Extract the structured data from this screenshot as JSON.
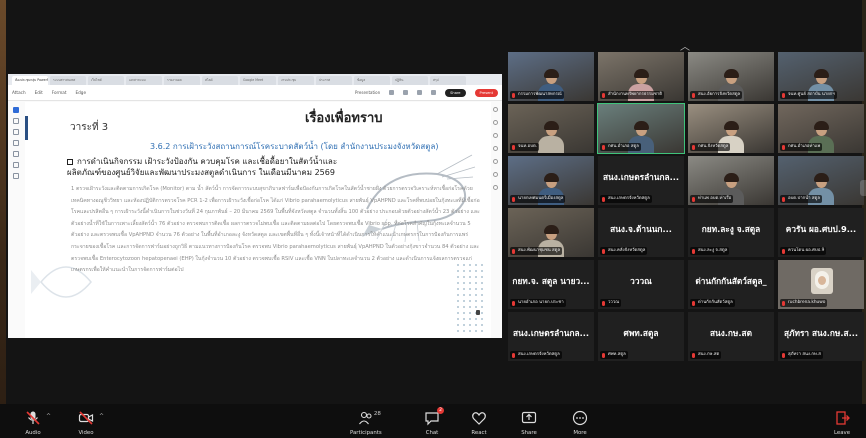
{
  "shared_screen": {
    "tabs": [
      "ห้องประชุมกลุ่ม PowerPoint",
      "ระบบสารสนเทศ",
      "เว็บไซต์",
      "เอกสารแนบ",
      "รายงานผล",
      "สไลด์",
      "Google Meet",
      "งานประชุม",
      "ประกาศ",
      "ข้อมูล",
      "ปฏิทิน",
      "สรุป"
    ],
    "menu": [
      "Attach",
      "Edit",
      "Format",
      "Edge"
    ],
    "view_label": "Presentation",
    "share_label": "Share",
    "present_label": "Present",
    "slide": {
      "agenda": "วาระที่ 3",
      "title": "เรื่องเพื่อทราบ",
      "subheading": "3.6.2 การเฝ้าระวังสถานการณ์โรคระบาดสัตว์น้ำ (โดย สำนักงานประมงจังหวัดสตูล)",
      "bullet": "การดำเนินกิจกรรม เฝ้าระวังป้องกัน ควบคุมโรค และเชื้อดื้อยาในสัตว์น้ำและผลิตภัณฑ์ของศูนย์วิจัยและพัฒนาประมงสตูลดำเนินการ ในเดือนมีนาคม 2569",
      "body": "1 ตรวจเฝ้าระวังและติดตามการเกิดโรค (Monitor) ตาม น้ำ สัตว์น้ำ การจัดการระบบสุขาภิบาลฟาร์มเพื่อป้องกันการเกิดโรคในสัตว์น้ำชายฝั่ง ด้วยการตรวจวิเคราะห์หาเชื้อก่อโรคด้วยเทคนิคทางอณูชีววิทยา และห้องปฏิบัติการตรวจโรค PCR 1-2 เพื่อการเฝ้าระวังเชื้อก่อโรค ได้แก่ Vibrio parahaemolyticus สายพันธุ์ VpAHPND และโรคที่พบบ่อยในกุ้งทะเลที่มีเชื้อก่อโรคและปรสิตอื่น ๆ การเฝ้าระวังนี้ดำเนินการในช่วงวันที่ 24 กุมภาพันธ์ – 20 มีนาคม 2569 ในพื้นที่จังหวัดสตูล จำนวนทั้งสิ้น 100 ตัวอย่าง ประกอบด้วยตัวอย่างสัตว์น้ำ 23 ตัวอย่าง และตัวอย่างน้ำที่ใช้ในการเพาะเลี้ยงสัตว์น้ำ 76 ตัวอย่าง ตรวจพบการติดเชื้อ ผลการตรวจไม่พบเชื้อ และติดตามผลต่อไป โดยตรวจพบเชื้อ Vibrio spp. ที่ก่อโรคสำคัญในกุ้งทะเลจำนวน 5 ตัวอย่าง และตรวจพบเชื้อ VpAHPND จำนวน 76 ตัวอย่าง ในพื้นที่อำเภอละงู จังหวัดสตูล และเขตพื้นที่อื่น ๆ ทั้งนี้เจ้าหน้าที่ได้ดำเนินการให้คำแนะนำเกษตรกรในการป้องกันการแพร่กระจายของเชื้อโรค และการจัดการฟาร์มอย่างถูกวิธี ตามแนวทางการป้องกันโรค ตรวจพบ Vibrio parahaemolyticus สายพันธุ์ VpAHPND ในตัวอย่างกุ้งขาวจำนวน 84 ตัวอย่าง และตรวจพบเชื้อ Enterocytozoon hepatopenaei (EHP) ในกุ้งจำนวน 10 ตัวอย่าง ตรวจพบเชื้อ RSIV และเชื้อ VNN ในปลาทะเลจำนวน 2 ตัวอย่าง และดำเนินการแจ้งผลการตรวจแก่เกษตรกรเพื่อให้คำแนะนำในการจัดการฟาร์มต่อไป"
    }
  },
  "participants_tiles": [
    {
      "name": "กรรมการพัฒนาสหกรณ์",
      "video": true
    },
    {
      "name": "สำนักงานทรัพยากรธรรมชาติ",
      "video": true
    },
    {
      "name": "สนง.อัยการจังหวัดสตูล",
      "video": true
    },
    {
      "name": "จนท.ศูนย์ สถาบัน นายกฯ",
      "video": true
    },
    {
      "name": "จนท.อบต.",
      "video": true
    },
    {
      "name": "กศน.อำเภอ สตูล",
      "video": true
    },
    {
      "name": "กศน.จังหวัดสตูล",
      "video": true
    },
    {
      "name": "กศน.อำเภอท่าแพ",
      "video": true
    },
    {
      "name": "นายกเทศมนตรีเมืองสตูล",
      "video": true,
      "big": ""
    },
    {
      "name": "สนง.เกษตรจังหวัดสตูล",
      "video": false,
      "big": "สนง.เกษตรลำนกล..."
    },
    {
      "name": "ท่าแพ อบต.ท่าเรือ",
      "video": true
    },
    {
      "name": "อบต.ปากน้ำ สตูล",
      "video": true
    },
    {
      "name": "สนง.พัฒนาชุมชน สตูล",
      "video": true
    },
    {
      "name": "สนง.คลังจังหวัดสตูล",
      "video": false,
      "big": "สนง.จ.ด้านนก..."
    },
    {
      "name": "สนง.ละงู จ.สตูล",
      "video": false,
      "big": "กยท.ละงู จ.สตูล"
    },
    {
      "name": "ควนโดน ผอ.ศบป.9",
      "video": false,
      "big": "ควรัน ผอ.ศบป.9..."
    },
    {
      "name": "นายอำเภอ นายก.ประชา",
      "video": false,
      "big": "กยท.จ. สตูล นายว..."
    },
    {
      "name": "วววณ",
      "video": false,
      "big": "วววณ"
    },
    {
      "name": "ด่านกักกันสัตว์สตูล",
      "video": false,
      "big": "ด่านกักกันสัตว์สตูล_"
    },
    {
      "name": "ruchbrena.khuwo",
      "video": true,
      "avatar": true
    },
    {
      "name": "สนง.เกษตรจังหวัดสตูล",
      "video": false,
      "big": "สนง.เกษตรลำนกล..."
    },
    {
      "name": "ศพท.สตูล",
      "video": false,
      "big": "ศพท.สตูล"
    },
    {
      "name": "สนง.กษ.สต",
      "video": false,
      "big": "สนง.กษ.สต"
    },
    {
      "name": "สุภัทรา สนง.กษ.ส",
      "video": false,
      "big": "สุภัทรา สนง.กษ.ส..."
    }
  ],
  "toolbar": {
    "audio": "Audio",
    "video": "Video",
    "participants": "Participants",
    "participants_count": "28",
    "chat": "Chat",
    "chat_badge": "2",
    "react": "React",
    "share": "Share",
    "more": "More",
    "leave": "Leave"
  },
  "colors": {
    "accent_red": "#e53935",
    "active_speaker": "#3fc37a",
    "slide_blue": "#2f6fb3"
  }
}
